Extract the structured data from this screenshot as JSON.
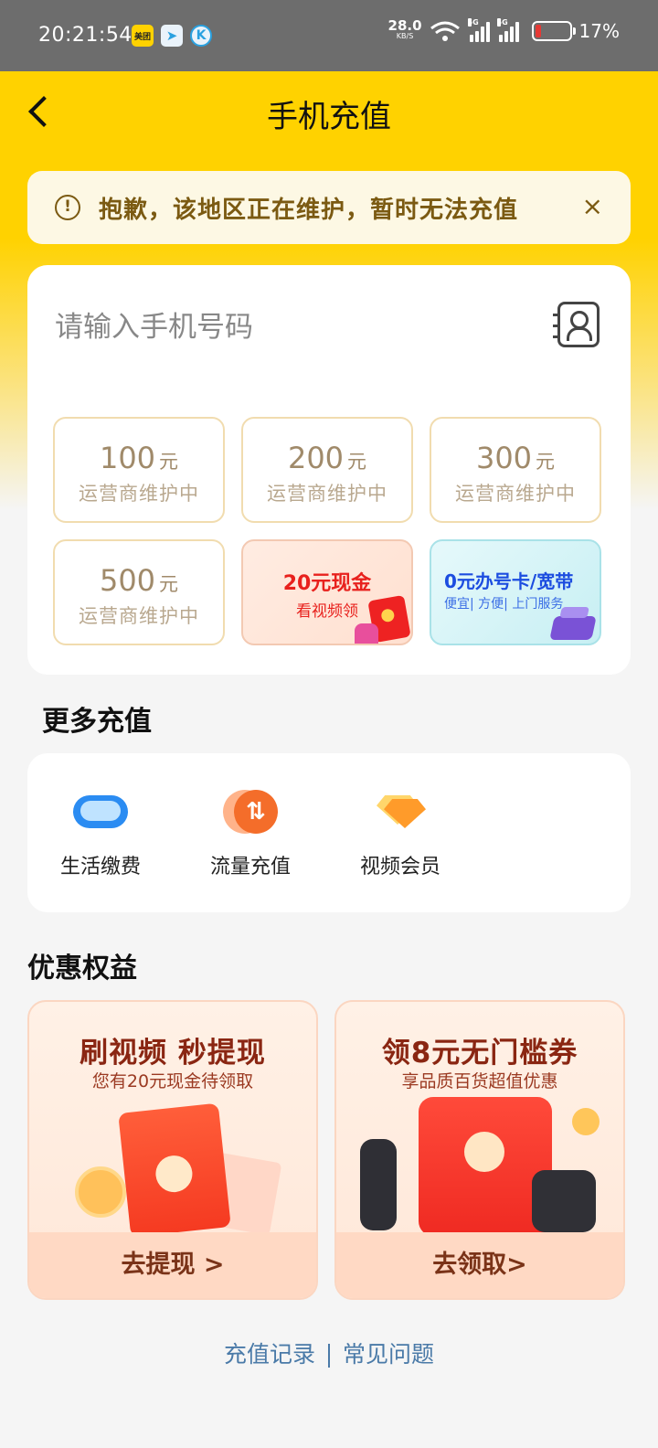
{
  "status_bar": {
    "time": "20:21:54",
    "apps": [
      "美团",
      "telegram-icon",
      "K"
    ],
    "speed_value": "28.0",
    "speed_unit": "KB/S",
    "network_1": "5G",
    "network_2": "5G",
    "battery_percent": "17%",
    "battery_level": 0.17
  },
  "header": {
    "title": "手机充值"
  },
  "notice": {
    "text": "抱歉，该地区正在维护，暂时无法充值",
    "close": "×"
  },
  "recharge": {
    "phone_placeholder": "请输入手机号码",
    "amounts": [
      {
        "value": "100",
        "unit": "元",
        "status": "运营商维护中"
      },
      {
        "value": "200",
        "unit": "元",
        "status": "运营商维护中"
      },
      {
        "value": "300",
        "unit": "元",
        "status": "运营商维护中"
      },
      {
        "value": "500",
        "unit": "元",
        "status": "运营商维护中"
      }
    ],
    "promo_cash": {
      "title": "20元现金",
      "subtitle": "看视频领"
    },
    "promo_card": {
      "title": "0元办号卡/宽带",
      "subtitle": "便宜| 方便| 上门服务"
    }
  },
  "more": {
    "title": "更多充值",
    "services": [
      {
        "label": "生活缴费",
        "icon": "cloud-icon"
      },
      {
        "label": "流量充值",
        "icon": "data-transfer-icon"
      },
      {
        "label": "视频会员",
        "icon": "diamond-icon"
      }
    ]
  },
  "benefits": {
    "title": "优惠权益",
    "cards": [
      {
        "title": "刷视频 秒提现",
        "subtitle": "您有20元现金待领取",
        "action": "去提现 >"
      },
      {
        "title": "领8元无门槛券",
        "subtitle": "享品质百货超值优惠",
        "action": "去领取>"
      }
    ]
  },
  "footer_links": {
    "records": "充值记录",
    "faq": "常见问题"
  },
  "colors": {
    "brand_yellow": "#ffd200",
    "notice_text": "#7b5a12",
    "link": "#4a7aa8"
  }
}
